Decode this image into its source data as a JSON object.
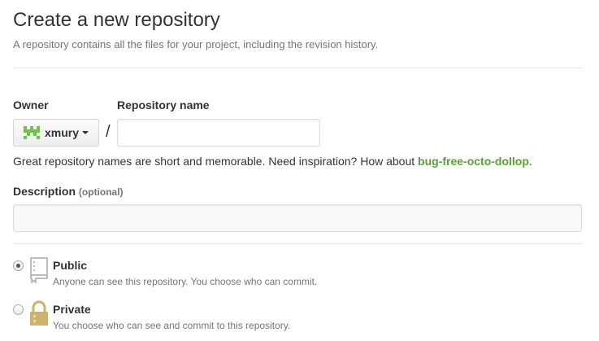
{
  "header": {
    "title": "Create a new repository",
    "subtitle": "A repository contains all the files for your project, including the revision history."
  },
  "form": {
    "owner_label": "Owner",
    "owner_name": "xmury",
    "separator": "/",
    "repo_name_label": "Repository name",
    "repo_name_value": "",
    "hint_text": "Great repository names are short and memorable. Need inspiration? How about ",
    "suggestion": "bug-free-octo-dollop",
    "hint_end": ".",
    "description_label": "Description",
    "description_optional": "(optional)",
    "description_value": ""
  },
  "visibility": {
    "public": {
      "title": "Public",
      "description": "Anyone can see this repository. You choose who can commit.",
      "selected": true,
      "icon": "repo-book-icon"
    },
    "private": {
      "title": "Private",
      "description": "You choose who can see and commit to this repository.",
      "selected": false,
      "icon": "lock-icon"
    }
  },
  "colors": {
    "suggestion": "#55a532",
    "avatar": "#6cc644",
    "icon": "#bbbbbb",
    "lock": "#d0b36a"
  }
}
